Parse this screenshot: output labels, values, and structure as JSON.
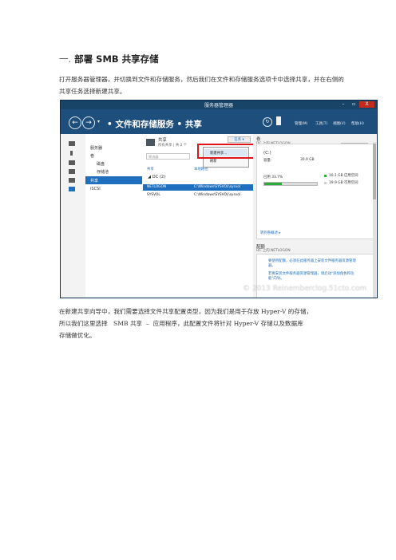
{
  "doc": {
    "heading_num": "一.",
    "heading_text": "部署 SMB 共享存储",
    "para1": "打开服务器管理器，并切换到文件和存储服务，然后我们在文件和存储服务选项卡中选择共享，并在右侧的共享任务选择新建共享。",
    "para2_lines": [
      "在新建共享向导中，我们需要选择文件共享配置类型，因为我们是用于存放 Hyper-V 的存储，",
      "所以我们这里选择   SMB 共享  –  应用程序，此配置文件将针对 Hyper-V 存储以及数据库",
      "存储做优化。"
    ]
  },
  "screenshot": {
    "window_title": "服务器管理器",
    "window_buttons": [
      "–",
      "▫",
      "X"
    ],
    "breadcrumb": "• 文件和存储服务 • 共享",
    "nav_dropdown": "▾",
    "toolbar": [
      "管理(M)",
      "工具(T)",
      "视图(V)",
      "帮助(H)"
    ],
    "left_nav": [
      "服务器",
      "卷",
      "磁盘",
      "存储池",
      "共享",
      "iSCSI"
    ],
    "shares_panel": {
      "title": "共享",
      "subtitle": "所有共享 | 共 2 个",
      "tasks_label": "任务 ▾",
      "search_placeholder": "筛选器",
      "col_share": "共享",
      "col_path": "本地路径",
      "group": "◢ DC (2)",
      "rows": [
        {
          "name": "NETLOGON",
          "path": "C:\\Windows\\SYSVOL\\sysvol"
        },
        {
          "name": "SYSVOL",
          "path": "C:\\Windows\\SYSVOL\\sysvol"
        }
      ]
    },
    "tasks_menu": [
      "新建共享...",
      "刷新"
    ],
    "volume_card": {
      "title": "卷",
      "subtitle": "DC 上的 NETLOGON",
      "tasks_label": "任务  ▾",
      "drive": "(C:)",
      "capacity_label": "容量:",
      "capacity_value": "30.0 GB",
      "used_label": "已用 33.7%",
      "used_fraction": 0.337,
      "used_space": "10.1 GB 已用空间",
      "free_space": "19.9 GB 可用空间",
      "go_to_volumes": "转到卷概述 ▸"
    },
    "quota_card": {
      "title": "配额",
      "subtitle": "DC 上的 NETLOGON",
      "msg1": "要使用配额，必须在此服务器上安装文件服务器资源管理器。",
      "msg2": "若要安装文件服务器资源管理器，请启动\"添加角色和功能\"向导。"
    },
    "watermark": "© 2013 Reinemberclog.51cto.com",
    "colors": {
      "title_bar": "#184468",
      "window_bg": "#1e4f7c",
      "selection": "#1f6fbf",
      "highlight_box": "#e0151b",
      "used_bar": "#2cab3a"
    }
  }
}
